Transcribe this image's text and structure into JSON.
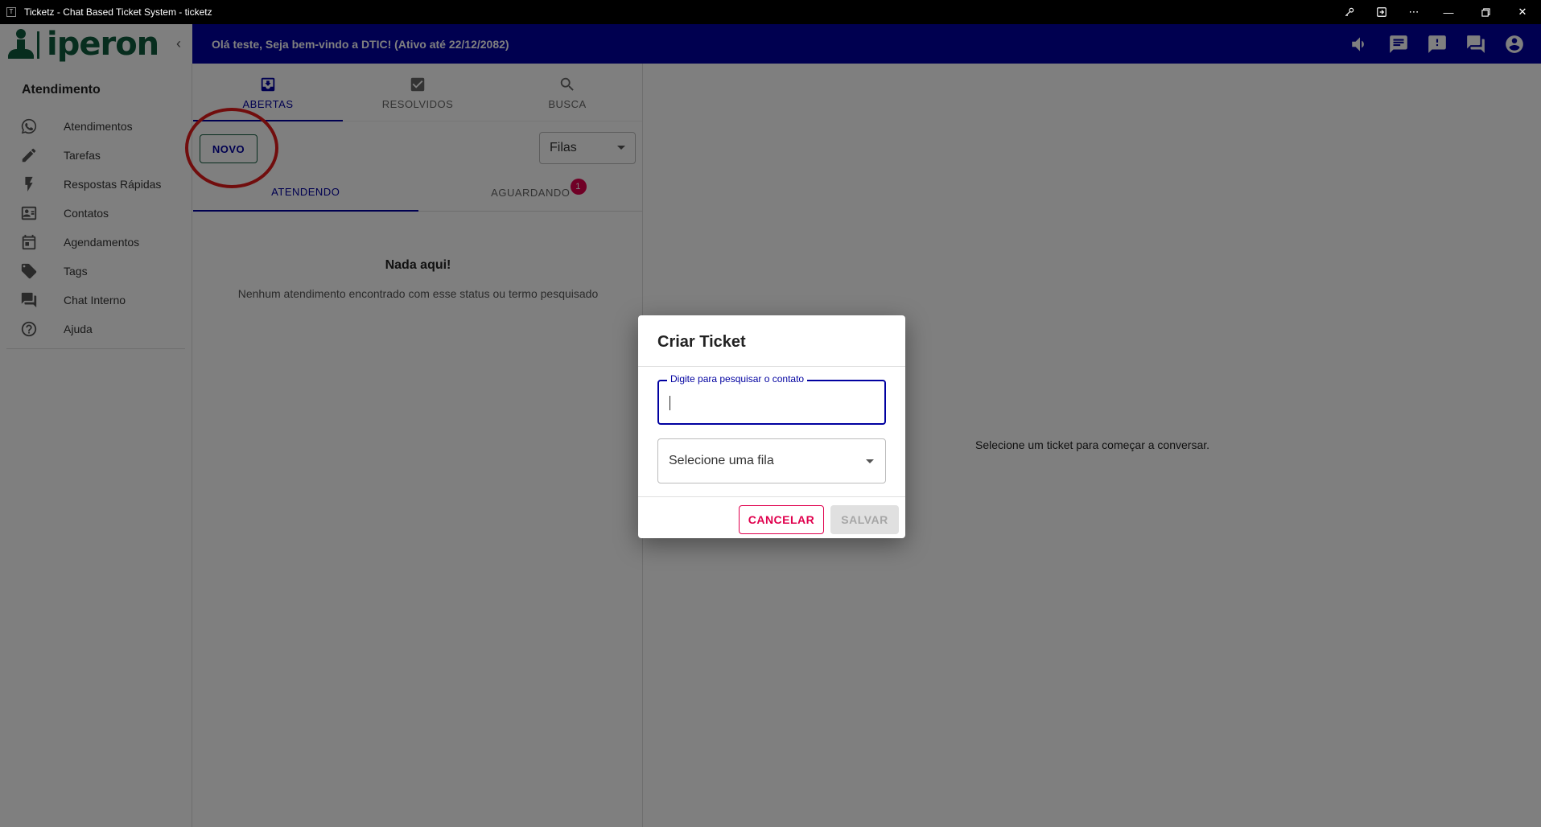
{
  "window": {
    "title": "Ticketz - Chat Based Ticket System - ticketz",
    "app_icon": "T"
  },
  "logo": {
    "brand": "iperon"
  },
  "appbar": {
    "welcome": "Olá teste, Seja bem-vindo a DTIC! (Ativo até 22/12/2082)",
    "icons": [
      "volume-icon",
      "chat-icon",
      "alert-icon",
      "forum-icon",
      "account-icon"
    ]
  },
  "sidebar": {
    "section": "Atendimento",
    "items": [
      {
        "label": "Atendimentos",
        "icon": "whatsapp-icon"
      },
      {
        "label": "Tarefas",
        "icon": "pencil-icon"
      },
      {
        "label": "Respostas Rápidas",
        "icon": "flash-icon"
      },
      {
        "label": "Contatos",
        "icon": "contacts-icon"
      },
      {
        "label": "Agendamentos",
        "icon": "calendar-icon"
      },
      {
        "label": "Tags",
        "icon": "tag-icon"
      },
      {
        "label": "Chat Interno",
        "icon": "forum-icon"
      },
      {
        "label": "Ajuda",
        "icon": "help-icon"
      }
    ]
  },
  "tickets": {
    "tabs": [
      "ABERTAS",
      "RESOLVIDOS",
      "BUSCA"
    ],
    "new_button": "NOVO",
    "queue_select": "Filas",
    "subtabs": [
      "ATENDENDO",
      "AGUARDANDO"
    ],
    "waiting_badge": "1",
    "empty_title": "Nada aqui!",
    "empty_text": "Nenhum atendimento encontrado com esse status ou termo pesquisado"
  },
  "main": {
    "placeholder": "Selecione um ticket para começar a conversar."
  },
  "dialog": {
    "title": "Criar Ticket",
    "search_label": "Digite para pesquisar o contato",
    "queue_placeholder": "Selecione uma fila",
    "cancel": "CANCELAR",
    "save": "SALVAR"
  },
  "colors": {
    "primary": "#0000a0",
    "brand_green": "#0f5a3c",
    "accent": "#e0004d",
    "highlight_circle": "#e31b1b"
  }
}
